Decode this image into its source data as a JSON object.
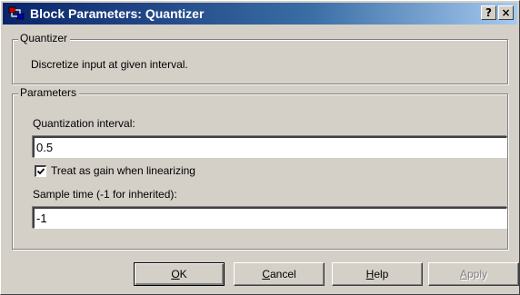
{
  "window": {
    "title": "Block Parameters: Quantizer",
    "help_button": "?",
    "close_button": "×"
  },
  "quantizer_group": {
    "label": "Quantizer",
    "description": "Discretize input at given interval."
  },
  "parameters_group": {
    "label": "Parameters",
    "quantization_interval_label": "Quantization interval:",
    "quantization_interval_value": "0.5",
    "treat_as_gain_label": "Treat as gain when linearizing",
    "treat_as_gain_checked": true,
    "sample_time_label": "Sample time (-1 for inherited):",
    "sample_time_value": "-1"
  },
  "buttons": {
    "ok": {
      "mnemonic": "O",
      "rest": "K"
    },
    "cancel": {
      "mnemonic": "C",
      "rest": "ancel"
    },
    "help": {
      "mnemonic": "H",
      "rest": "elp"
    },
    "apply": {
      "mnemonic": "A",
      "rest": "pply",
      "enabled": false
    }
  },
  "colors": {
    "title_bar_start": "#0a246a",
    "title_bar_end": "#a6caf0",
    "face": "#d4d0c8"
  }
}
